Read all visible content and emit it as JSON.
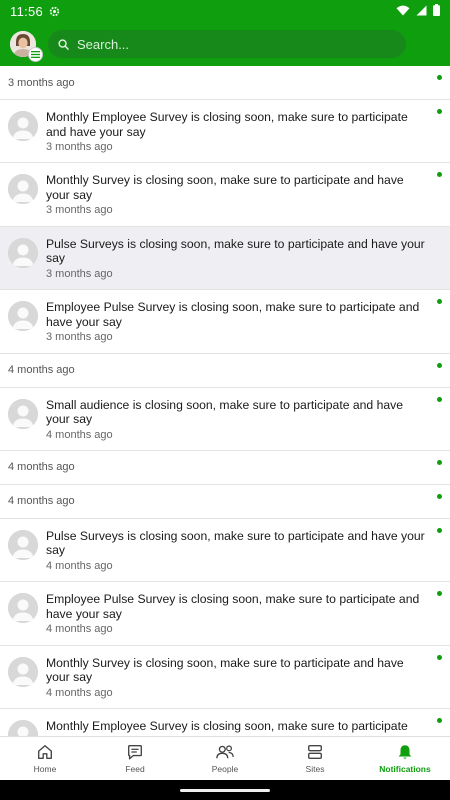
{
  "status_bar": {
    "time": "11:56"
  },
  "header": {
    "search_placeholder": "Search..."
  },
  "notifications": [
    {
      "kind": "group",
      "time": "3 months ago"
    },
    {
      "kind": "item",
      "text": "Monthly Employee Survey is closing soon, make sure to participate and have your say",
      "time": "3 months ago"
    },
    {
      "kind": "item",
      "text": "Monthly Survey is closing soon, make sure to participate and have your say",
      "time": "3 months ago"
    },
    {
      "kind": "item",
      "text": "Pulse Surveys is closing soon, make sure to participate and have your say",
      "time": "3 months ago",
      "highlighted": true,
      "unread": false
    },
    {
      "kind": "item",
      "text": "Employee Pulse Survey is closing soon, make sure to participate and have your say",
      "time": "3 months ago"
    },
    {
      "kind": "group",
      "time": "4 months ago"
    },
    {
      "kind": "item",
      "text": "Small audience is closing soon, make sure to participate and have your say",
      "time": "4 months ago"
    },
    {
      "kind": "group",
      "time": "4 months ago"
    },
    {
      "kind": "group",
      "time": "4 months ago"
    },
    {
      "kind": "item",
      "text": "Pulse Surveys is closing soon, make sure to participate and have your say",
      "time": "4 months ago"
    },
    {
      "kind": "item",
      "text": "Employee Pulse Survey is closing soon, make sure to participate and have your say",
      "time": "4 months ago"
    },
    {
      "kind": "item",
      "text": "Monthly Survey is closing soon, make sure to participate and have your say",
      "time": "4 months ago"
    },
    {
      "kind": "item",
      "text": "Monthly Employee Survey is closing soon, make sure to participate",
      "time": ""
    }
  ],
  "bottom_nav": [
    {
      "label": "Home",
      "icon": "home-icon",
      "active": false
    },
    {
      "label": "Feed",
      "icon": "feed-icon",
      "active": false
    },
    {
      "label": "People",
      "icon": "people-icon",
      "active": false
    },
    {
      "label": "Sites",
      "icon": "sites-icon",
      "active": false
    },
    {
      "label": "Notifications",
      "icon": "bell-icon",
      "active": true
    }
  ],
  "colors": {
    "brand": "#0e9e0e",
    "unread_dot": "#0e9e0e",
    "highlight_row": "#efeff3"
  }
}
